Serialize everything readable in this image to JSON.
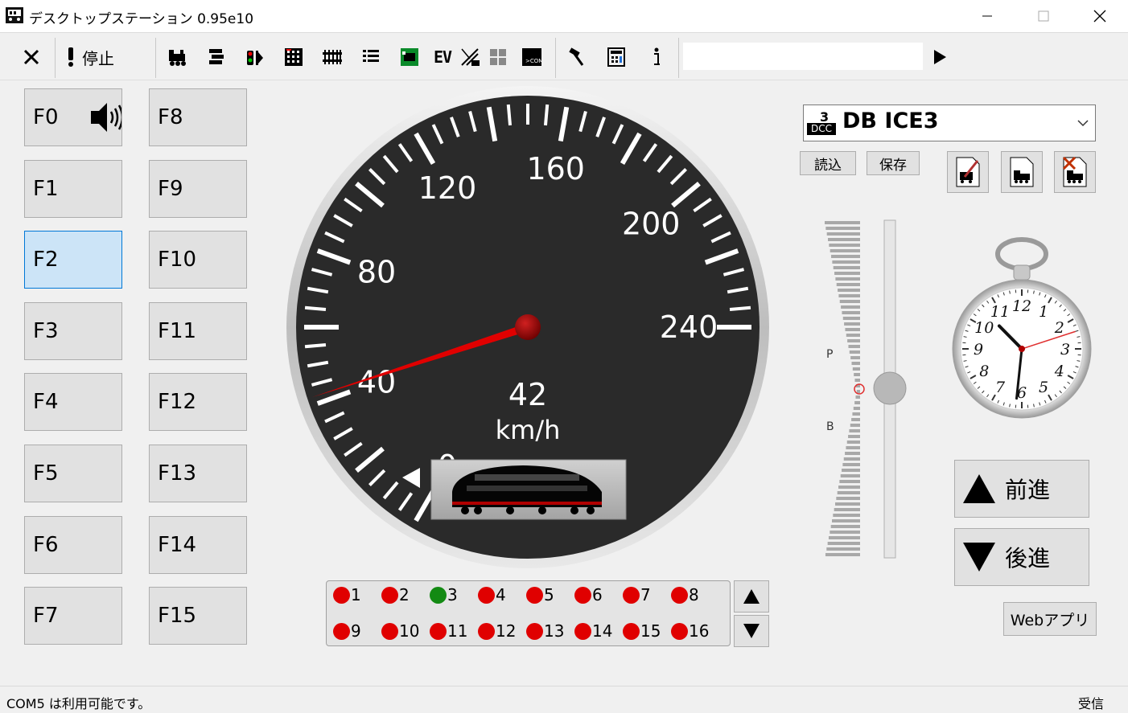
{
  "window": {
    "title": "デスクトップステーション 0.95e10"
  },
  "toolbar": {
    "stop_label": "停止",
    "ev_label": "EV",
    "command_input_value": "",
    "icons": [
      "close-icon",
      "alert-icon",
      "loco-list-icon",
      "accessory-icon",
      "signal-icon",
      "layout-panel-icon",
      "track-icon",
      "list-icon",
      "s88-icon",
      "ev-icon",
      "crane-icon",
      "grid-icon",
      "console-icon",
      "hammer-icon",
      "calculator-icon",
      "info-icon",
      "run-icon"
    ]
  },
  "functions": {
    "left": [
      "F0",
      "F1",
      "F2",
      "F3",
      "F4",
      "F5",
      "F6",
      "F7"
    ],
    "right": [
      "F8",
      "F9",
      "F10",
      "F11",
      "F12",
      "F13",
      "F14",
      "F15"
    ],
    "active": "F2"
  },
  "speedometer": {
    "ticks": [
      "0",
      "40",
      "80",
      "120",
      "160",
      "200",
      "240"
    ],
    "speed": "42",
    "unit": "km/h",
    "max": 240,
    "needle_value": 42
  },
  "loco": {
    "name": "DB ICE3",
    "address": "3",
    "protocol": "DCC",
    "load_label": "読込",
    "save_label": "保存"
  },
  "throttle": {
    "p_label": "P",
    "b_label": "B",
    "position": 0.5
  },
  "clock": {
    "numerals": [
      "12",
      "1",
      "2",
      "3",
      "4",
      "5",
      "6",
      "7",
      "8",
      "9",
      "10",
      "11"
    ],
    "hour": 10,
    "minute": 31,
    "second": 12
  },
  "direction": {
    "forward_label": "前進",
    "reverse_label": "後進"
  },
  "web_button": "Webアプリ",
  "s88": {
    "sensors": [
      "1",
      "2",
      "3",
      "4",
      "5",
      "6",
      "7",
      "8",
      "9",
      "10",
      "11",
      "12",
      "13",
      "14",
      "15",
      "16"
    ],
    "states": [
      0,
      0,
      1,
      0,
      0,
      0,
      0,
      0,
      0,
      0,
      0,
      0,
      0,
      0,
      0,
      0
    ],
    "on_color": "#138a13",
    "off_color": "#e00000"
  },
  "status": {
    "message": "COM5 は利用可能です。",
    "receive": "受信"
  }
}
